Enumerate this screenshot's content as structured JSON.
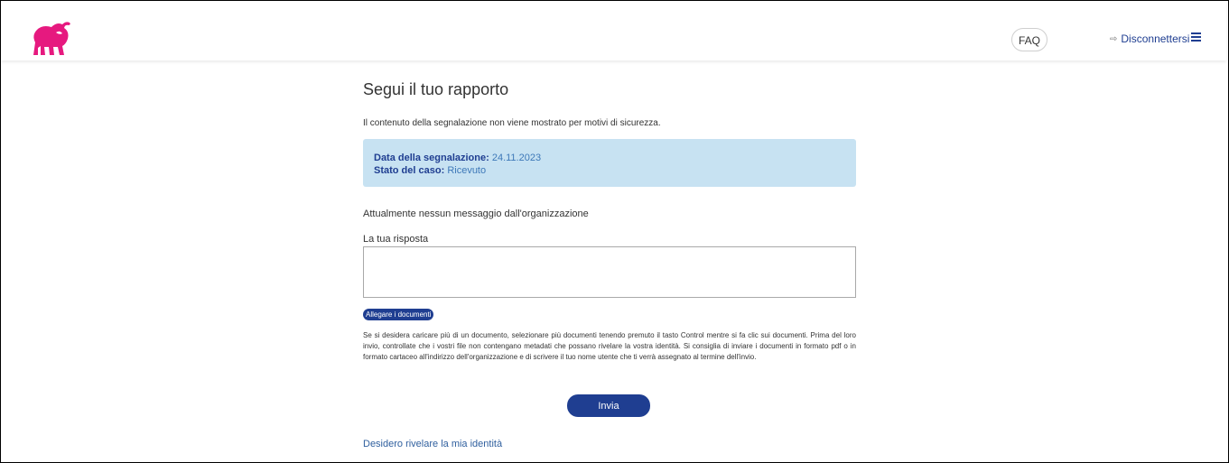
{
  "header": {
    "faq_label": "FAQ",
    "logout_label": "Disconnettersi",
    "logout_icon": "logout-arrow-icon",
    "menu_icon": "hamburger-menu-icon",
    "logo_color": "#e6197f"
  },
  "main": {
    "title": "Segui il tuo rapporto",
    "security_note": "Il contenuto della segnalazione non viene mostrato per motivi di sicurezza.",
    "report": {
      "date_label": "Data della segnalazione:",
      "date_value": "24.11.2023",
      "status_label": "Stato del caso:",
      "status_value": "Ricevuto"
    },
    "no_messages": "Attualmente nessun messaggio dall'organizzazione",
    "reply_label": "La tua risposta",
    "reply_value": "",
    "attach_label": "Allegare i documenti",
    "help_text": "Se si desidera caricare più di un documento, selezionare più documenti tenendo premuto il tasto Control mentre si fa clic sui documenti. Prima del loro invio, controllate che i vostri file non contengano metadati che possano rivelare la vostra identità. Si consiglia di inviare i documenti in formato pdf o in formato cartaceo all'indirizzo dell'organizzazione e di scrivere il tuo nome utente che ti verrà assegnato al termine dell'invio.",
    "submit_label": "Invia",
    "reveal_identity_link": "Desidero rivelare la mia identità"
  },
  "colors": {
    "brand": "#1f3e91",
    "info_bg": "#c7e2f2",
    "logo": "#e6197f"
  }
}
